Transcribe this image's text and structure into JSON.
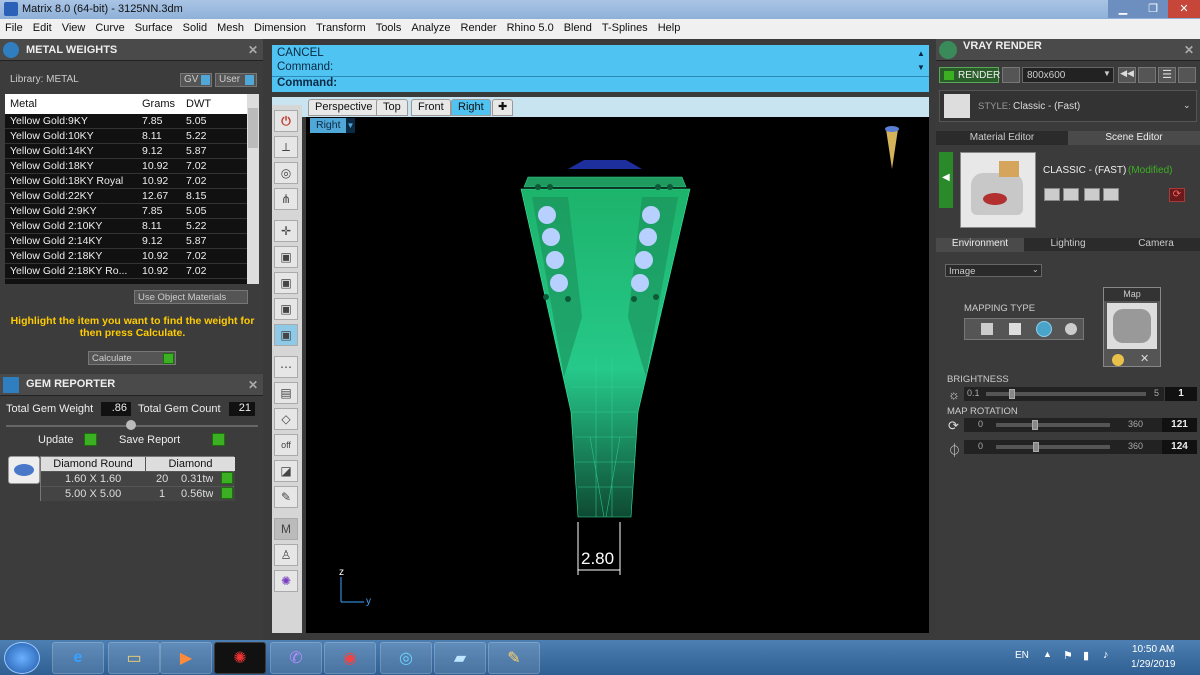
{
  "window": {
    "title": "Matrix 8.0 (64-bit) - 3125NN.3dm"
  },
  "menu": [
    "File",
    "Edit",
    "View",
    "Curve",
    "Surface",
    "Solid",
    "Mesh",
    "Dimension",
    "Transform",
    "Tools",
    "Analyze",
    "Render",
    "Rhino 5.0",
    "Blend",
    "T-Splines",
    "Help"
  ],
  "metal_weights": {
    "title": "METAL WEIGHTS",
    "library_label": "Library: METAL",
    "gv_label": "GV",
    "user_label": "User",
    "columns": [
      "Metal",
      "Grams",
      "DWT"
    ],
    "rows": [
      [
        "Yellow Gold:9KY",
        "7.85",
        "5.05"
      ],
      [
        "Yellow Gold:10KY",
        "8.11",
        "5.22"
      ],
      [
        "Yellow Gold:14KY",
        "9.12",
        "5.87"
      ],
      [
        "Yellow Gold:18KY",
        "10.92",
        "7.02"
      ],
      [
        "Yellow Gold:18KY Royal",
        "10.92",
        "7.02"
      ],
      [
        "Yellow Gold:22KY",
        "12.67",
        "8.15"
      ],
      [
        "Yellow Gold 2:9KY",
        "7.85",
        "5.05"
      ],
      [
        "Yellow Gold 2:10KY",
        "8.11",
        "5.22"
      ],
      [
        "Yellow Gold 2:14KY",
        "9.12",
        "5.87"
      ],
      [
        "Yellow Gold 2:18KY",
        "10.92",
        "7.02"
      ],
      [
        "Yellow Gold 2:18KY Ro...",
        "10.92",
        "7.02"
      ]
    ],
    "use_object_materials": "Use Object Materials",
    "hint": "Highlight the item you want to find the weight for then press Calculate.",
    "calculate_label": "Calculate"
  },
  "gem_reporter": {
    "title": "GEM REPORTER",
    "total_weight_label": "Total Gem Weight",
    "total_weight_value": ".86",
    "total_count_label": "Total Gem Count",
    "total_count_value": "21",
    "update_label": "Update",
    "save_report_label": "Save Report",
    "shape": "Diamond Round",
    "material": "Diamond",
    "gems": [
      [
        "1.60 X 1.60",
        "20",
        "0.31tw"
      ],
      [
        "5.00 X 5.00",
        "1",
        "0.56tw"
      ]
    ]
  },
  "command": {
    "line1": "CANCEL",
    "line2": "Command:",
    "line3": "Command:"
  },
  "viewport": {
    "tabs": [
      "Perspective",
      "Top",
      "Front",
      "Right"
    ],
    "active_tab": "Right",
    "label": "Right",
    "dimension": "2.80",
    "axis_z": "z",
    "axis_y": "y"
  },
  "vray": {
    "title": "VRAY RENDER",
    "render_label": "RENDER",
    "resolution": "800x600",
    "style_label": "STYLE:",
    "style_value": "Classic - (Fast)",
    "editor_tabs": [
      "Material Editor",
      "Scene Editor"
    ],
    "scene_name": "CLASSIC - (FAST)",
    "modified": "(Modified)",
    "section_tabs": [
      "Environment",
      "Lighting",
      "Camera"
    ],
    "env_type": "Image",
    "mapping_type_label": "MAPPING TYPE",
    "map_label": "Map",
    "brightness_label": "BRIGHTNESS",
    "brightness_min": "0.1",
    "brightness_max": "5",
    "brightness_value": "1",
    "map_rotation_label": "MAP ROTATION",
    "rot1_min": "0",
    "rot1_max": "360",
    "rot1_value": "121",
    "rot2_min": "0",
    "rot2_max": "360",
    "rot2_value": "124"
  },
  "taskbar": {
    "lang": "EN",
    "time": "10:50 AM",
    "date": "1/29/2019"
  },
  "colors": {
    "accent": "#4fc3f1",
    "model": "#1db36b",
    "hint": "#ffcc00"
  }
}
